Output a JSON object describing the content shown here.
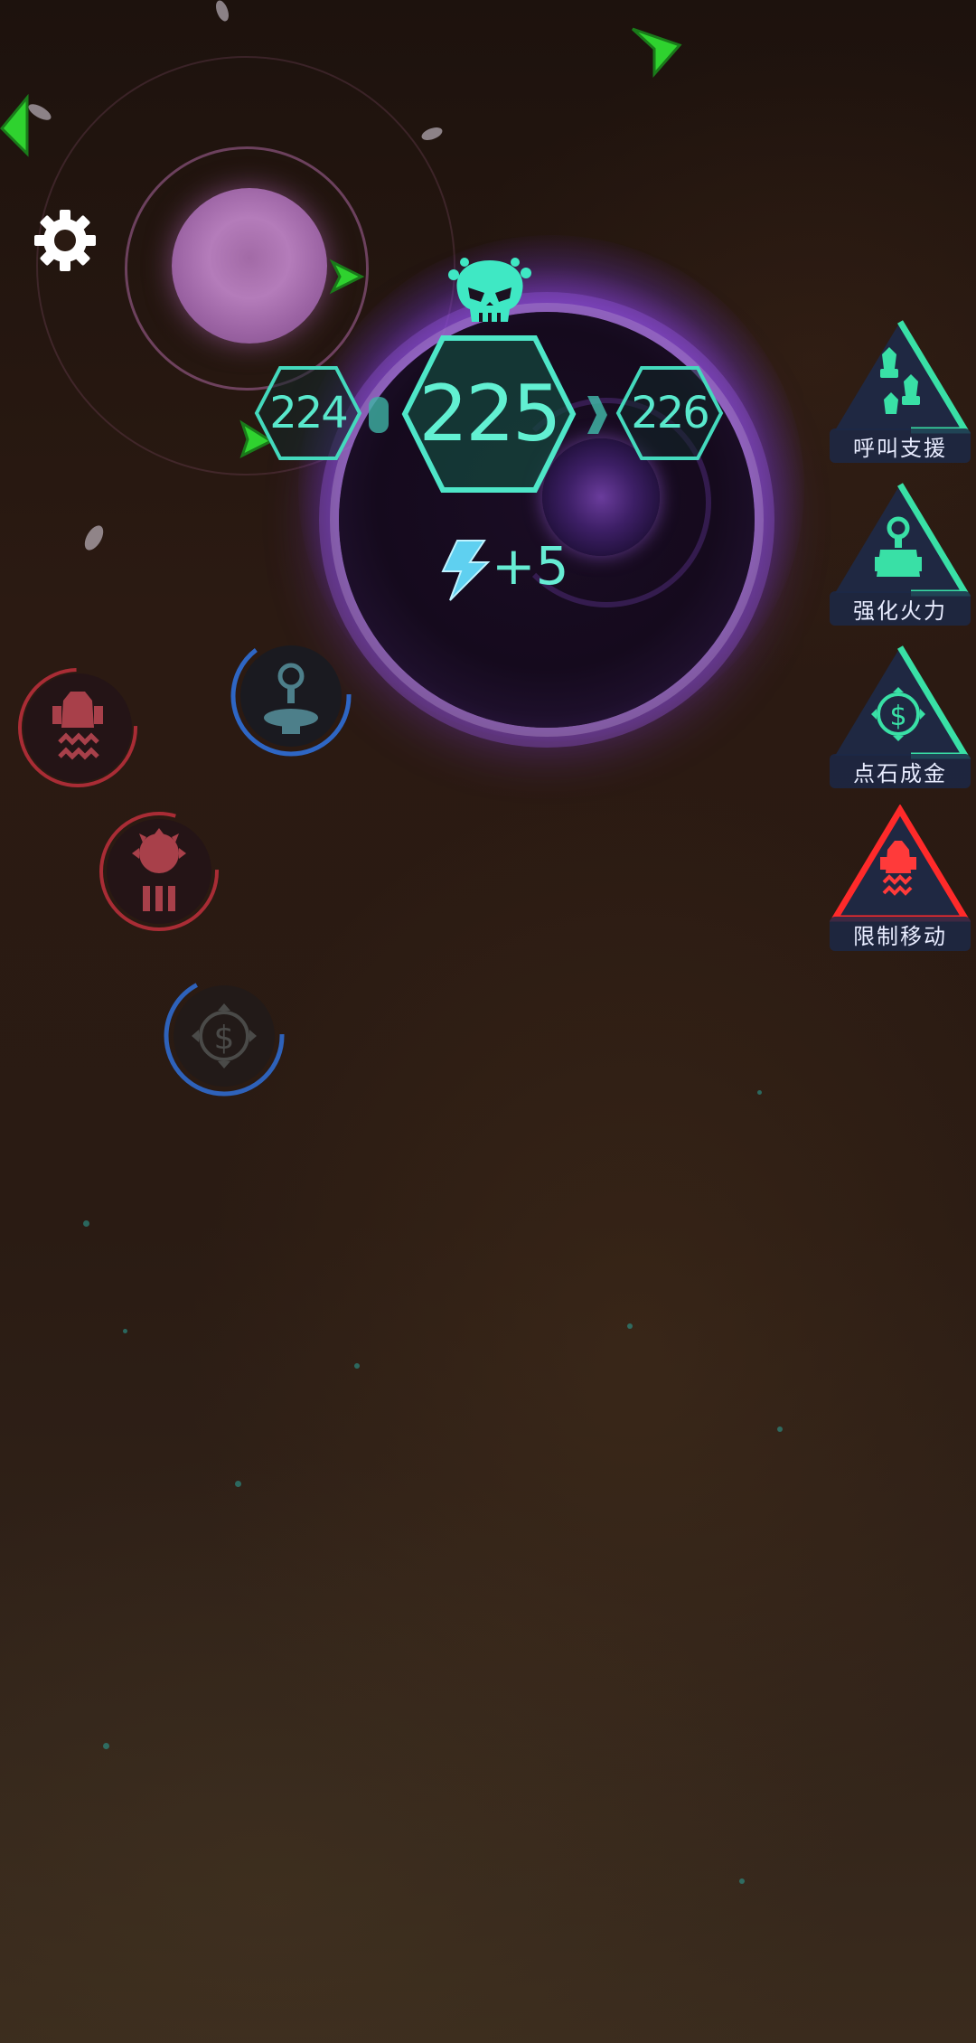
{
  "hud": {
    "settings_icon": "gear-icon",
    "boss_icon": "skull-icon",
    "level_prev": "224",
    "level_current": "225",
    "level_next": "226",
    "energy_icon": "lightning-icon",
    "energy_reward": "+5"
  },
  "skills": [
    {
      "label": "呼叫支援",
      "icon": "support-ships-icon",
      "color": "#39e0a6"
    },
    {
      "label": "强化火力",
      "icon": "turret-icon",
      "color": "#39e0a6"
    },
    {
      "label": "点石成金",
      "icon": "gold-coin-icon",
      "color": "#39e0a6"
    },
    {
      "label": "限制移动",
      "icon": "restricted-ship-icon",
      "color": "#ff2a2a"
    }
  ],
  "pickups": [
    {
      "icon": "restricted-ship-icon",
      "color": "#d8404a"
    },
    {
      "icon": "turret-icon",
      "color": "#3a7be0"
    },
    {
      "icon": "sun-boost-icon",
      "color": "#d8404a"
    },
    {
      "icon": "gold-coin-icon",
      "color": "#3a7be0"
    }
  ]
}
